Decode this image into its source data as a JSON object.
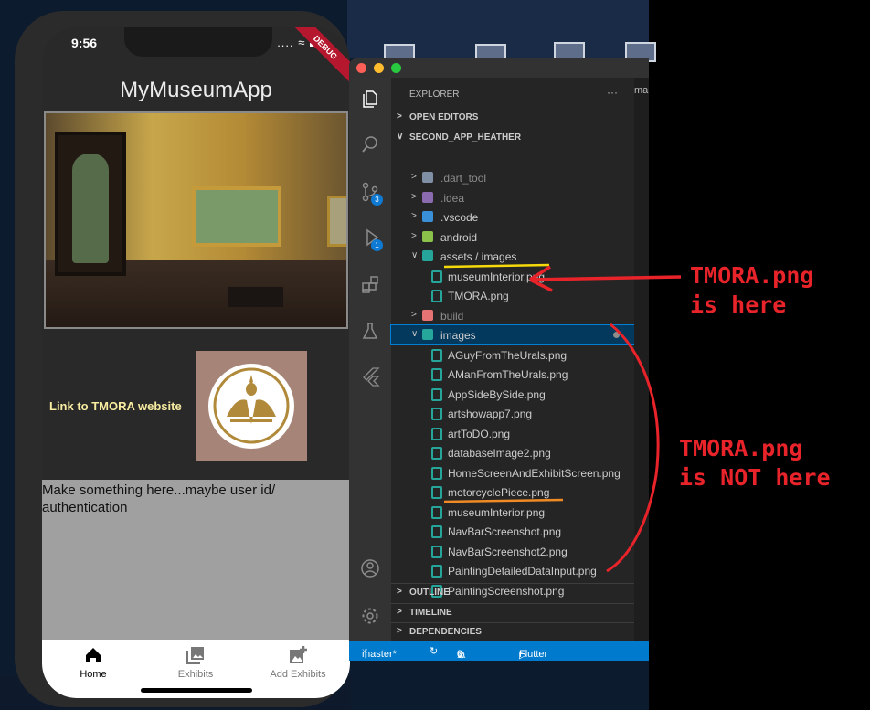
{
  "phone": {
    "time": "9:56",
    "status_icons": ".... ≈ ▬",
    "debug_banner": "DEBUG",
    "app_title": "MyMuseumApp",
    "link_text": "Link to TMORA website",
    "placeholder_text": "Make something here...maybe user id/ authentication",
    "nav": [
      {
        "label": "Home",
        "icon": "home-icon",
        "active": true
      },
      {
        "label": "Exhibits",
        "icon": "gallery-icon",
        "active": false
      },
      {
        "label": "Add Exhibits",
        "icon": "add-photo-icon",
        "active": false
      }
    ]
  },
  "vscode": {
    "explorer_title": "EXPLORER",
    "more_actions": "···",
    "open_editors": "OPEN EDITORS",
    "project": "SECOND_APP_HEATHER",
    "peek_tab": "mai",
    "tree": [
      {
        "name": ".dart_tool",
        "kind": "folder",
        "expanded": false,
        "depth": 1,
        "dim": true,
        "icon_color": "#7f8fa6"
      },
      {
        "name": ".idea",
        "kind": "folder",
        "expanded": false,
        "depth": 1,
        "dim": true,
        "icon_color": "#8a6bb0"
      },
      {
        "name": ".vscode",
        "kind": "folder",
        "expanded": false,
        "depth": 1,
        "dim": false,
        "icon_color": "#3a8fd9"
      },
      {
        "name": "android",
        "kind": "folder",
        "expanded": false,
        "depth": 1,
        "dim": false,
        "icon_color": "#8bc34a"
      },
      {
        "name": "assets / images",
        "kind": "folder",
        "expanded": true,
        "depth": 1,
        "dim": false,
        "icon_color": "#26a69a"
      },
      {
        "name": "museumInterior.png",
        "kind": "file",
        "depth": 2,
        "icon_color": "#26a69a"
      },
      {
        "name": "TMORA.png",
        "kind": "file",
        "depth": 2,
        "icon_color": "#26a69a"
      },
      {
        "name": "build",
        "kind": "folder",
        "expanded": false,
        "depth": 1,
        "dim": true,
        "icon_color": "#e57373"
      },
      {
        "name": "images",
        "kind": "folder",
        "expanded": true,
        "depth": 1,
        "selected": true,
        "icon_color": "#26a69a"
      },
      {
        "name": "AGuyFromTheUrals.png",
        "kind": "file",
        "depth": 2,
        "icon_color": "#26a69a"
      },
      {
        "name": "AManFromTheUrals.png",
        "kind": "file",
        "depth": 2,
        "icon_color": "#26a69a"
      },
      {
        "name": "AppSideBySide.png",
        "kind": "file",
        "depth": 2,
        "icon_color": "#26a69a"
      },
      {
        "name": "artshowapp7.png",
        "kind": "file",
        "depth": 2,
        "icon_color": "#26a69a"
      },
      {
        "name": "artToDO.png",
        "kind": "file",
        "depth": 2,
        "icon_color": "#26a69a"
      },
      {
        "name": "databaseImage2.png",
        "kind": "file",
        "depth": 2,
        "icon_color": "#26a69a"
      },
      {
        "name": "HomeScreenAndExhibitScreen.png",
        "kind": "file",
        "depth": 2,
        "icon_color": "#26a69a"
      },
      {
        "name": "motorcyclePiece.png",
        "kind": "file",
        "depth": 2,
        "icon_color": "#26a69a"
      },
      {
        "name": "museumInterior.png",
        "kind": "file",
        "depth": 2,
        "icon_color": "#26a69a"
      },
      {
        "name": "NavBarScreenshot.png",
        "kind": "file",
        "depth": 2,
        "icon_color": "#26a69a"
      },
      {
        "name": "NavBarScreenshot2.png",
        "kind": "file",
        "depth": 2,
        "icon_color": "#26a69a"
      },
      {
        "name": "PaintingDetailedDataInput.png",
        "kind": "file",
        "depth": 2,
        "icon_color": "#26a69a"
      },
      {
        "name": "PaintingScreenshot.png",
        "kind": "file",
        "depth": 2,
        "icon_color": "#26a69a"
      }
    ],
    "sections": [
      "OUTLINE",
      "TIMELINE",
      "DEPENDENCIES"
    ],
    "activity_badges": {
      "source_control": "3",
      "run_debug": "1"
    },
    "status": {
      "branch": "master*",
      "problems_errors": "0",
      "problems_warnings": "0",
      "flutter": "Flutter (second_app_Hea"
    },
    "colors": {
      "accent": "#007acc",
      "selection": "#04395e"
    }
  },
  "annotations": {
    "here": "TMORA.png\nis here",
    "not_here": "TMORA.png\nis NOT here",
    "color": "#e8232a",
    "underline_assets": "#f5d90a",
    "underline_images": "#f08a24"
  }
}
